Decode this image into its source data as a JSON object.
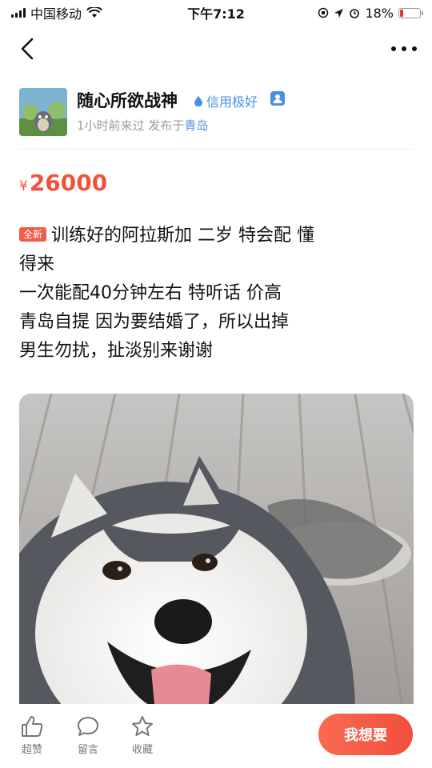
{
  "status_bar": {
    "carrier": "中国移动",
    "time": "下午7:12",
    "battery": "18%",
    "battery_level": 0.18
  },
  "seller": {
    "name": "随心所欲战神",
    "credit": "信用极好",
    "meta_prefix": "1小时前来过  发布于",
    "location": "青岛"
  },
  "listing": {
    "price_symbol": "¥",
    "price": "26000",
    "badge": "全新",
    "lines": [
      "训练好的阿拉斯加 二岁  特会配 懂",
      "得来",
      "一次能配40分钟左右 特听话 价高",
      "青岛自提 因为要结婚了，所以出掉",
      "男生勿扰，扯淡别来谢谢"
    ]
  },
  "bottom_bar": {
    "like": "超赞",
    "comment": "留言",
    "favorite": "收藏",
    "want": "我想要"
  },
  "colors": {
    "accent": "#f0523b",
    "link": "#4a8fe6"
  }
}
